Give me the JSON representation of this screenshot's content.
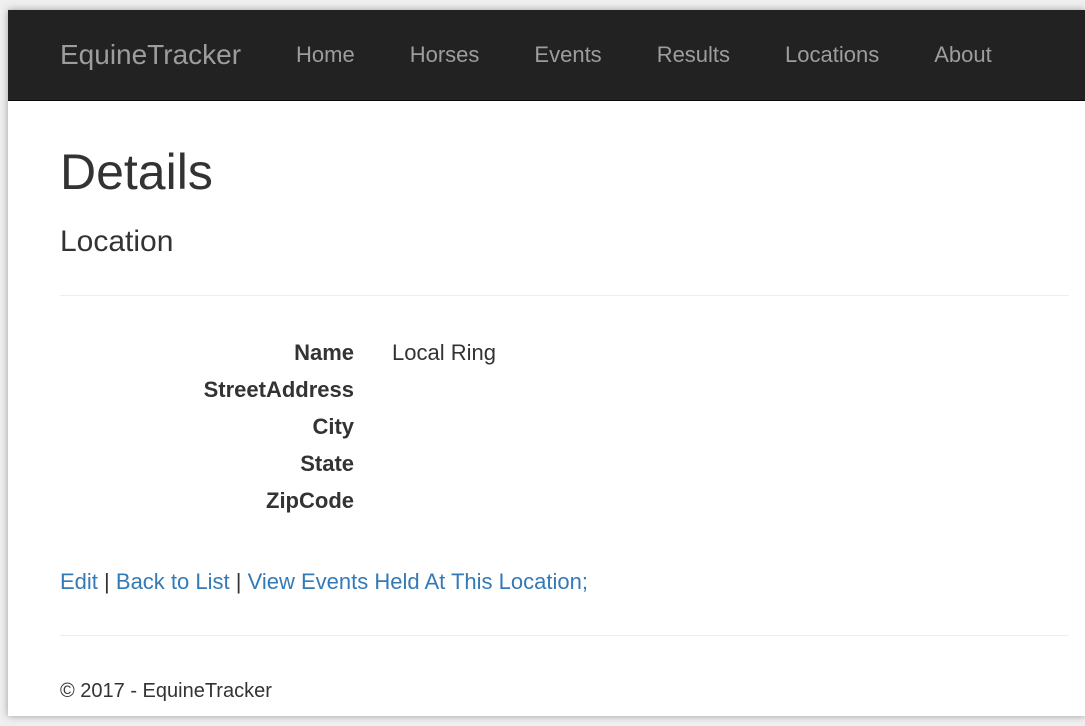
{
  "navbar": {
    "brand": "EquineTracker",
    "links": [
      "Home",
      "Horses",
      "Events",
      "Results",
      "Locations",
      "About"
    ]
  },
  "page": {
    "title": "Details",
    "subtitle": "Location"
  },
  "details": [
    {
      "label": "Name",
      "value": "Local Ring"
    },
    {
      "label": "StreetAddress",
      "value": ""
    },
    {
      "label": "City",
      "value": ""
    },
    {
      "label": "State",
      "value": ""
    },
    {
      "label": "ZipCode",
      "value": ""
    }
  ],
  "actions": {
    "edit": "Edit",
    "separator": "|",
    "back": "Back to List",
    "view_events": "View Events Held At This Location",
    "trailing": ";"
  },
  "footer": {
    "text": "© 2017 - EquineTracker"
  },
  "colors": {
    "navbar_bg": "#222222",
    "navbar_text": "#9d9d9d",
    "link": "#337ab7",
    "text": "#333333"
  }
}
